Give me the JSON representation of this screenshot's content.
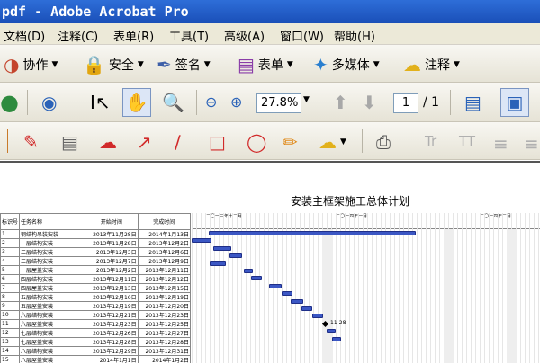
{
  "window": {
    "title": "pdf - Adobe Acrobat Pro"
  },
  "menu": [
    "文档(D)",
    "注释(C)",
    "表单(R)",
    "工具(T)",
    "高级(A)",
    "窗口(W)",
    "帮助(H)"
  ],
  "toolbar1": {
    "create": "协作",
    "secure": "安全",
    "sign": "签名",
    "forms": "表单",
    "multimedia": "多媒体",
    "comment": "注释"
  },
  "toolbar2": {
    "zoom": "27.8%",
    "page_current": "1",
    "page_total": "/ 1"
  },
  "document": {
    "title": "安装主框架施工总体计划",
    "table_headers": [
      "标识号",
      "任务名称",
      "开始时间",
      "完成时间"
    ],
    "rows": [
      [
        "1",
        "钢结构吊装安装",
        "2013年11月28日",
        "2014年1月13日"
      ],
      [
        "2",
        "一层结构安装",
        "2013年11月28日",
        "2013年12月2日"
      ],
      [
        "3",
        "二层结构安装",
        "2013年12月3日",
        "2013年12月6日"
      ],
      [
        "4",
        "三层结构安装",
        "2013年12月7日",
        "2013年12月9日"
      ],
      [
        "5",
        "一层屋盖安装",
        "2013年12月2日",
        "2013年12月11日"
      ],
      [
        "6",
        "四层结构安装",
        "2013年12月11日",
        "2013年12月12日"
      ],
      [
        "7",
        "四层屋盖安装",
        "2013年12月13日",
        "2013年12月15日"
      ],
      [
        "8",
        "五层结构安装",
        "2013年12月16日",
        "2013年12月19日"
      ],
      [
        "9",
        "五层屋盖安装",
        "2013年12月19日",
        "2013年12月20日"
      ],
      [
        "10",
        "六层结构安装",
        "2013年12月21日",
        "2013年12月23日"
      ],
      [
        "11",
        "六层屋盖安装",
        "2013年12月23日",
        "2013年12月25日"
      ],
      [
        "12",
        "七层结构安装",
        "2013年12月26日",
        "2013年12月27日"
      ],
      [
        "13",
        "七层屋盖安装",
        "2013年12月28日",
        "2013年12月28日"
      ],
      [
        "14",
        "八层结构安装",
        "2013年12月29日",
        "2013年12月31日"
      ],
      [
        "15",
        "八层屋盖安装",
        "2014年1月1日",
        "2014年1月2日"
      ]
    ],
    "gantt_months": [
      "二〇一三年十二月",
      "二〇一四年一月",
      "二〇一四年二月"
    ],
    "milestone_label": "11-28"
  }
}
